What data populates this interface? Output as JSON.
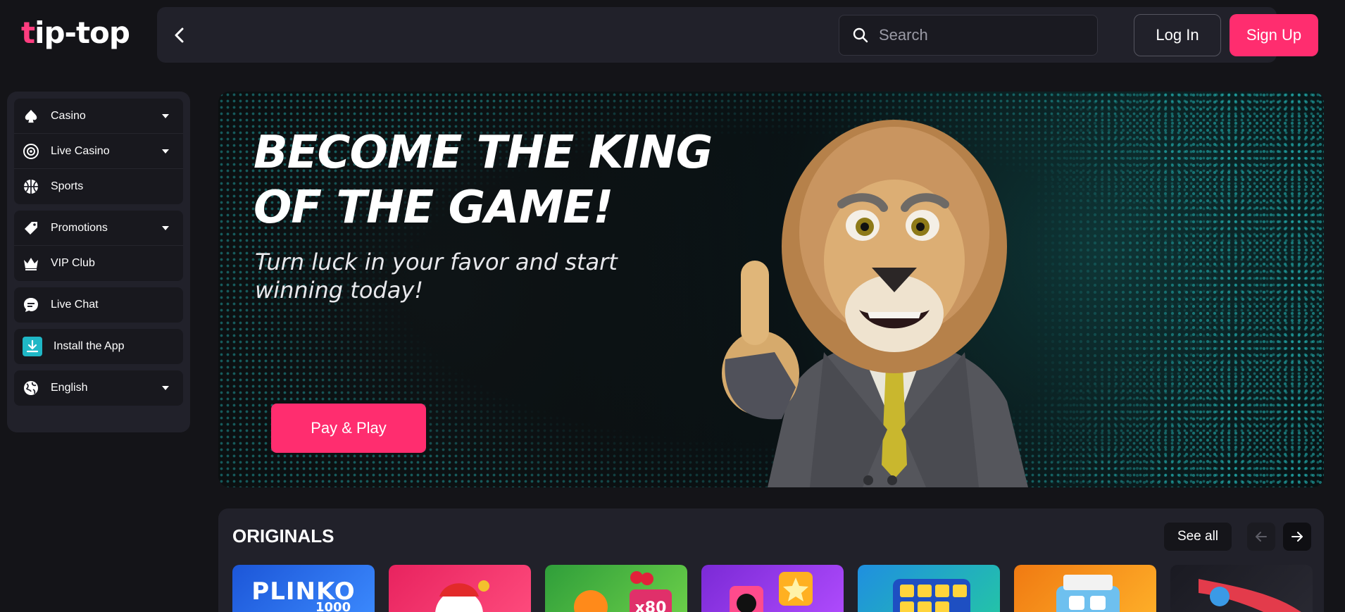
{
  "brand": {
    "logo_first": "t",
    "logo_rest": "ip-top",
    "accent": "#ff2d6f"
  },
  "header": {
    "search_placeholder": "Search",
    "login_label": "Log In",
    "signup_label": "Sign Up"
  },
  "sidebar": {
    "groups": [
      [
        {
          "label": "Casino",
          "icon": "spade-icon",
          "has_dropdown": true
        },
        {
          "label": "Live Casino",
          "icon": "chip-icon",
          "has_dropdown": true
        },
        {
          "label": "Sports",
          "icon": "basketball-icon",
          "has_dropdown": false
        }
      ],
      [
        {
          "label": "Promotions",
          "icon": "tag-icon",
          "has_dropdown": true
        },
        {
          "label": "VIP Club",
          "icon": "crown-icon",
          "has_dropdown": false
        }
      ],
      [
        {
          "label": "Live Chat",
          "icon": "chat-icon",
          "has_dropdown": false
        }
      ],
      [
        {
          "label": "Install the App",
          "icon": "download-icon",
          "has_dropdown": false
        }
      ],
      [
        {
          "label": "English",
          "icon": "globe-icon",
          "has_dropdown": true
        }
      ]
    ]
  },
  "hero": {
    "title": "BECOME THE KING OF THE GAME!",
    "subtitle": "Turn luck in your favor and start winning today!",
    "cta_label": "Pay & Play"
  },
  "originals": {
    "title": "ORIGINALS",
    "see_all_label": "See all",
    "tiles": [
      {
        "label": "PLINKO",
        "sublabel": "1000",
        "color_from": "#1c56d8",
        "color_to": "#3d8cff"
      },
      {
        "label": "",
        "sublabel": "",
        "color_from": "#e8235f",
        "color_to": "#ff4d7e"
      },
      {
        "label": "",
        "sublabel": "x80",
        "color_from": "#2f9e3a",
        "color_to": "#6fd24a"
      },
      {
        "label": "",
        "sublabel": "",
        "color_from": "#7b2ad6",
        "color_to": "#b24dff"
      },
      {
        "label": "",
        "sublabel": "",
        "color_from": "#1f8fe0",
        "color_to": "#24c7a4"
      },
      {
        "label": "",
        "sublabel": "",
        "color_from": "#f07a12",
        "color_to": "#ffb22a"
      },
      {
        "label": "",
        "sublabel": "",
        "color_from": "#1a1a22",
        "color_to": "#2a2a33"
      }
    ]
  }
}
